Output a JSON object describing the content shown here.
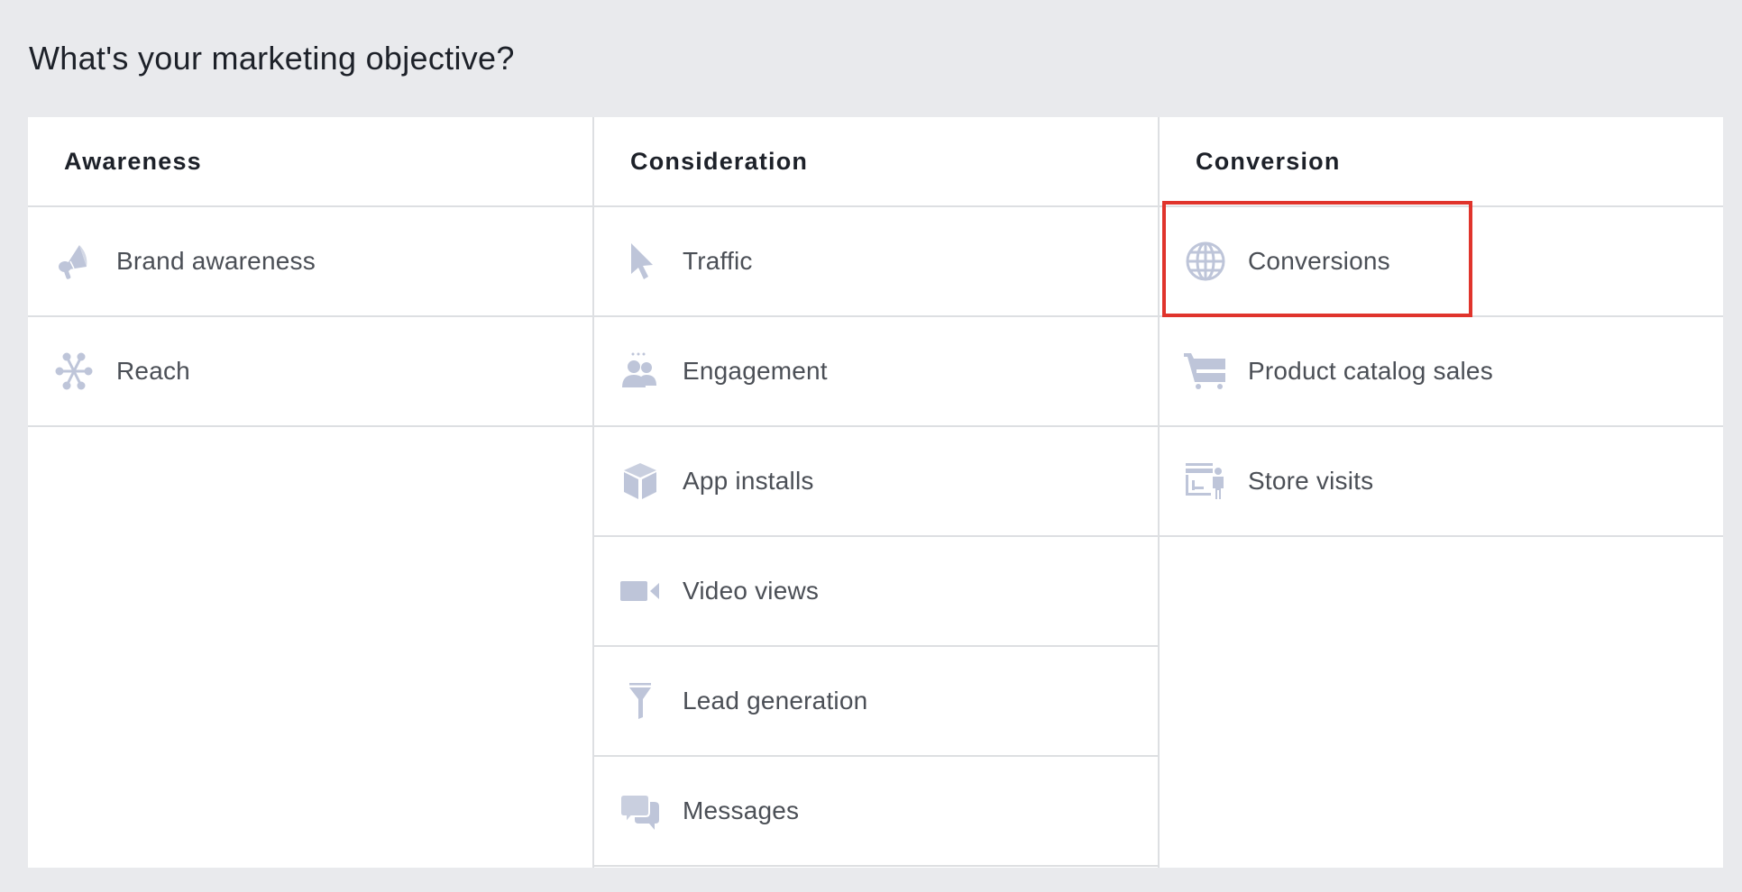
{
  "page": {
    "title": "What's your marketing objective?"
  },
  "colors": {
    "background": "#e9eaed",
    "panel": "#ffffff",
    "icon": "#bec5d9",
    "text": "#4b4f56",
    "heading": "#1d2129",
    "highlight": "#e0342c"
  },
  "columns": [
    {
      "heading": "Awareness",
      "items": [
        {
          "label": "Brand awareness",
          "icon": "megaphone-icon"
        },
        {
          "label": "Reach",
          "icon": "reach-network-icon"
        }
      ]
    },
    {
      "heading": "Consideration",
      "items": [
        {
          "label": "Traffic",
          "icon": "cursor-icon"
        },
        {
          "label": "Engagement",
          "icon": "people-icon"
        },
        {
          "label": "App installs",
          "icon": "box-icon"
        },
        {
          "label": "Video views",
          "icon": "video-camera-icon"
        },
        {
          "label": "Lead generation",
          "icon": "funnel-icon"
        },
        {
          "label": "Messages",
          "icon": "chat-bubbles-icon"
        }
      ]
    },
    {
      "heading": "Conversion",
      "items": [
        {
          "label": "Conversions",
          "icon": "globe-icon",
          "highlighted": true
        },
        {
          "label": "Product catalog sales",
          "icon": "shopping-cart-icon"
        },
        {
          "label": "Store visits",
          "icon": "store-visit-icon"
        }
      ]
    }
  ]
}
